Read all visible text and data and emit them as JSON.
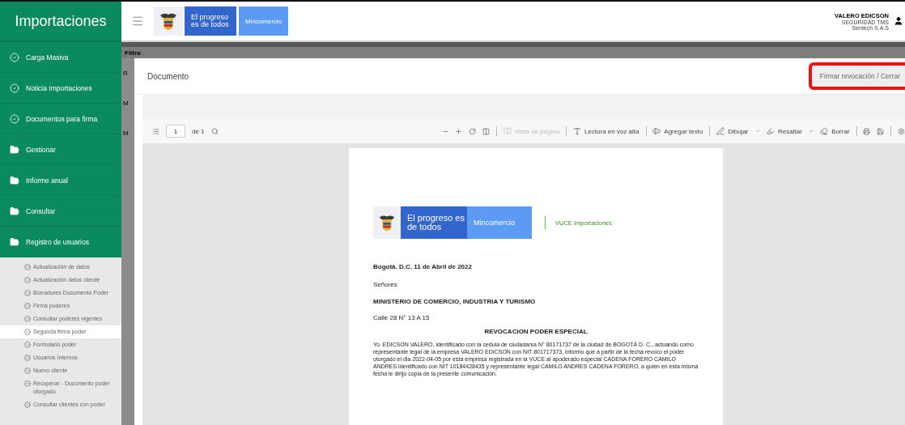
{
  "sidebar": {
    "title": "Importaciones",
    "items": [
      {
        "label": "Carga Masiva",
        "kind": "check"
      },
      {
        "label": "Noticia Importaciones",
        "kind": "check"
      },
      {
        "label": "Documentos para firma",
        "kind": "check"
      },
      {
        "label": "Gestionar",
        "kind": "folder"
      },
      {
        "label": "Informe anual",
        "kind": "folder"
      },
      {
        "label": "Consultar",
        "kind": "folder"
      },
      {
        "label": "Registro de usuarios",
        "kind": "folder"
      }
    ],
    "subitems": [
      {
        "label": "Actualización de datos",
        "selected": false
      },
      {
        "label": "Actualización datos cliente",
        "selected": false
      },
      {
        "label": "Borradores Documento Poder",
        "selected": false
      },
      {
        "label": "Firma poderes",
        "selected": false
      },
      {
        "label": "Consultar poderes vigentes",
        "selected": false
      },
      {
        "label": "Segunda firma poder",
        "selected": true
      },
      {
        "label": "Formulario poder",
        "selected": false
      },
      {
        "label": "Usuarios Internos",
        "selected": false
      },
      {
        "label": "Nuevo cliente",
        "selected": false
      },
      {
        "label": "Recuperar - Documento poder otorgado",
        "selected": false
      },
      {
        "label": "Consultar clientes con poder",
        "selected": false
      }
    ]
  },
  "header": {
    "slogan": "El progreso es de todos",
    "ministry": "Mincomercio",
    "user_name": "VALERO EDICSON",
    "user_role": "SEGURIDAD TMS",
    "user_company": "Sentech S.A.S"
  },
  "background": {
    "panel_title": "Filtro",
    "labels": [
      "R",
      "M",
      "M"
    ]
  },
  "modal": {
    "title": "Documento",
    "action_button": "Firmar revocación / Cerrar",
    "action_highlighted": true
  },
  "pdf_toolbar": {
    "page": "1",
    "page_count": "de 1",
    "view": {
      "label": "Vista de página",
      "disabled": true
    },
    "read_aloud": "Lectura en voz alta",
    "add_text": "Agregar texto",
    "draw": "Dibujar",
    "highlight": "Resaltar",
    "erase": "Borrar"
  },
  "document": {
    "slogan": "El progreso es de todos",
    "ministry": "Mincomercio",
    "program": "VUCE Importaciones",
    "date": "Bogotá. D.C.  11 de Abril  de 2022",
    "salutation": "Señores",
    "recipient": "MINISTERIO DE COMERCIO, INDUSTRIA Y TURISMO",
    "address": "Calle 28 N° 13 A 15",
    "subject": "REVOCACION PODER ESPECIAL",
    "body": "Yo.   EDICSON VALERO, identificado con la cedula de ciudadanía N° 80171737  de la ciudad de BOGOTÁ D. C., actuando como representante legal de la empresa VALERO EDICSON con NIT 801717373, informo que a partir de la fecha revoco el poder otorgado el dia 2022-04-05  por esta empresa registrada en la VUCE al apoderado especial CADENA FORERO CAMILO ANDRES identificado con NIT 10184428435 y representante legal CAMILO ANDRES CADENA FORERO, a quien en esta misma fecha le dirijo copia de la presente comunicación."
  }
}
